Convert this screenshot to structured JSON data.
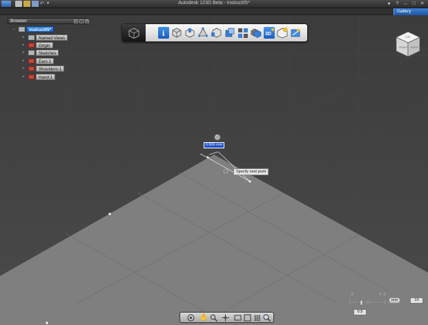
{
  "app": {
    "title": "Autodesk 123D Beta - instruct05*"
  },
  "gallery": {
    "label": "Gallery"
  },
  "browser": {
    "title": "Browser",
    "root": "instruct05*",
    "items": [
      {
        "label": "Named Views",
        "has_visibility": false
      },
      {
        "label": "Origin",
        "has_visibility": true
      },
      {
        "label": "Sketches",
        "has_visibility": false
      },
      {
        "label": "Ears:1",
        "has_visibility": true
      },
      {
        "label": "Shoulders:1",
        "has_visibility": true
      },
      {
        "label": "Hand:1",
        "has_visibility": true
      }
    ]
  },
  "toolbar": {
    "tools": [
      "info-icon",
      "primitive-box-icon",
      "sketch-icon",
      "construct-icon",
      "modify-icon",
      "pattern-icon",
      "grouping-icon",
      "combine-icon",
      "measure-icon",
      "text-3d-icon",
      "material-icon"
    ]
  },
  "dimension": {
    "value": "0.569 mm",
    "tooltip": "Specify next point"
  },
  "units": {
    "unit": "mm",
    "grid_size": "10",
    "snap": "0.5",
    "tick_left": "0",
    "tick_right": "4 : 5"
  },
  "colors": {
    "accent": "#1e5fc0",
    "viewport_bg": "#3a3a3a",
    "ground": "#808080"
  }
}
